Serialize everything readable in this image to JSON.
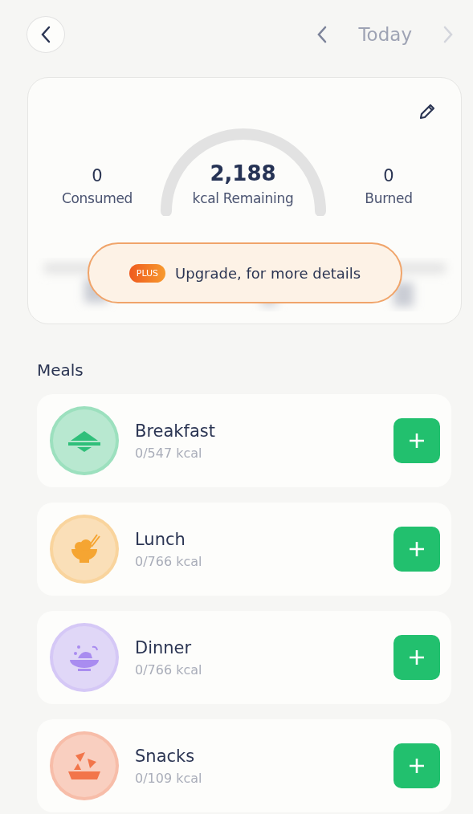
{
  "header": {
    "date_label": "Today",
    "prev_disabled": false,
    "next_disabled": true
  },
  "summary": {
    "consumed": {
      "value": "0",
      "label": "Consumed"
    },
    "remaining": {
      "value": "2,188",
      "label": "kcal Remaining"
    },
    "burned": {
      "value": "0",
      "label": "Burned"
    },
    "upgrade": {
      "badge": "PLUS",
      "text": "Upgrade, for more details"
    }
  },
  "meals_title": "Meals",
  "meals": [
    {
      "kind": "breakfast",
      "name": "Breakfast",
      "kcal": "0/547 kcal",
      "color": "#2fbf7a"
    },
    {
      "kind": "lunch",
      "name": "Lunch",
      "kcal": "0/766 kcal",
      "color": "#f5a532"
    },
    {
      "kind": "dinner",
      "name": "Dinner",
      "kcal": "0/766 kcal",
      "color": "#a98cf0"
    },
    {
      "kind": "snacks",
      "name": "Snacks",
      "kcal": "0/109 kcal",
      "color": "#f2754a"
    }
  ]
}
